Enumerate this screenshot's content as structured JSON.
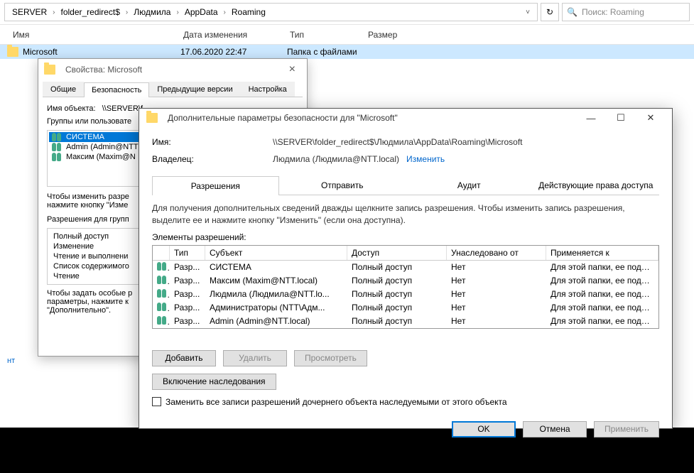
{
  "explorer": {
    "breadcrumb": [
      "SERVER",
      "folder_redirect$",
      "Людмила",
      "AppData",
      "Roaming"
    ],
    "search_placeholder": "Поиск: Roaming",
    "headers": {
      "name": "Имя",
      "date": "Дата изменения",
      "type": "Тип",
      "size": "Размер"
    },
    "row": {
      "name": "Microsoft",
      "date": "17.06.2020 22:47",
      "type": "Папка с файлами"
    },
    "link": "нт"
  },
  "props": {
    "title": "Свойства: Microsoft",
    "tabs": [
      "Общие",
      "Безопасность",
      "Предыдущие версии",
      "Настройка"
    ],
    "active_tab": 1,
    "object_label": "Имя объекта:",
    "object_value": "\\\\SERVER\\f",
    "groups_label": "Группы или пользовате",
    "groups": [
      "СИСТЕМА",
      "Admin (Admin@NTT",
      "Максим (Maxim@N"
    ],
    "hint1": "Чтобы изменить разре",
    "hint2": "нажмите кнопку \"Изме",
    "perm_for": "Разрешения для групп",
    "perms": [
      "Полный доступ",
      "Изменение",
      "Чтение и выполнени",
      "Список содержимого",
      "Чтение"
    ],
    "foot1": "Чтобы задать особые р",
    "foot2": "параметры, нажмите к",
    "foot3": "\"Дополнительно\"."
  },
  "adv": {
    "title": "Дополнительные параметры безопасности для \"Microsoft\"",
    "name_label": "Имя:",
    "name_value": "\\\\SERVER\\folder_redirect$\\Людмила\\AppData\\Roaming\\Microsoft",
    "owner_label": "Владелец:",
    "owner_value": "Людмила (Людмила@NTT.local)",
    "owner_change": "Изменить",
    "tabs": [
      "Разрешения",
      "Отправить",
      "Аудит",
      "Действующие права доступа"
    ],
    "active_tab": 0,
    "hint": "Для получения дополнительных сведений дважды щелкните запись разрешения. Чтобы изменить запись разрешения, выделите ее и нажмите кнопку \"Изменить\" (если она доступна).",
    "elements_label": "Элементы разрешений:",
    "table": {
      "headers": {
        "type": "Тип",
        "subject": "Субъект",
        "access": "Доступ",
        "inherited": "Унаследовано от",
        "applies": "Применяется к"
      },
      "rows": [
        {
          "type": "Разр...",
          "subject": "СИСТЕМА",
          "access": "Полный доступ",
          "inherited": "Нет",
          "applies": "Для этой папки, ее подпапок ..."
        },
        {
          "type": "Разр...",
          "subject": "Максим (Maxim@NTT.local)",
          "access": "Полный доступ",
          "inherited": "Нет",
          "applies": "Для этой папки, ее подпапок ..."
        },
        {
          "type": "Разр...",
          "subject": "Людмила (Людмила@NTT.lo...",
          "access": "Полный доступ",
          "inherited": "Нет",
          "applies": "Для этой папки, ее подпапок ..."
        },
        {
          "type": "Разр...",
          "subject": "Администраторы (NTT\\Адм...",
          "access": "Полный доступ",
          "inherited": "Нет",
          "applies": "Для этой папки, ее подпапок ..."
        },
        {
          "type": "Разр...",
          "subject": "Admin (Admin@NTT.local)",
          "access": "Полный доступ",
          "inherited": "Нет",
          "applies": "Для этой папки, ее подпапок ..."
        }
      ]
    },
    "buttons": {
      "add": "Добавить",
      "remove": "Удалить",
      "view": "Просмотреть",
      "inherit": "Включение наследования"
    },
    "checkbox": "Заменить все записи разрешений дочернего объекта наследуемыми от этого объекта",
    "footer": {
      "ok": "OK",
      "cancel": "Отмена",
      "apply": "Применить"
    }
  }
}
